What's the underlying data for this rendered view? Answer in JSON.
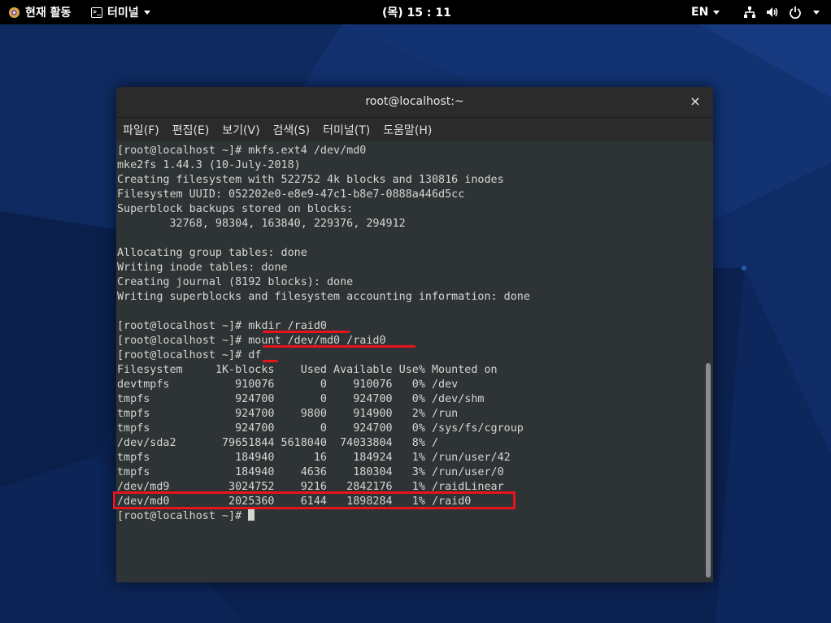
{
  "topbar": {
    "activities_label": "현재 활동",
    "app_menu_label": "터미널",
    "clock": "(목) 15 : 11",
    "language": "EN",
    "icons": [
      "network-icon",
      "volume-icon",
      "power-icon"
    ]
  },
  "window": {
    "title": "root@localhost:~",
    "close_glyph": "×",
    "menu": [
      "파일(F)",
      "편집(E)",
      "보기(V)",
      "검색(S)",
      "터미널(T)",
      "도움말(H)"
    ]
  },
  "terminal": {
    "lines": [
      "[root@localhost ~]# mkfs.ext4 /dev/md0",
      "mke2fs 1.44.3 (10-July-2018)",
      "Creating filesystem with 522752 4k blocks and 130816 inodes",
      "Filesystem UUID: 052202e0-e8e9-47c1-b8e7-0888a446d5cc",
      "Superblock backups stored on blocks:",
      "        32768, 98304, 163840, 229376, 294912",
      "",
      "Allocating group tables: done",
      "Writing inode tables: done",
      "Creating journal (8192 blocks): done",
      "Writing superblocks and filesystem accounting information: done",
      "",
      "[root@localhost ~]# mkdir /raid0",
      "[root@localhost ~]# mount /dev/md0 /raid0",
      "[root@localhost ~]# df",
      "Filesystem     1K-blocks    Used Available Use% Mounted on",
      "devtmpfs          910076       0    910076   0% /dev",
      "tmpfs             924700       0    924700   0% /dev/shm",
      "tmpfs             924700    9800    914900   2% /run",
      "tmpfs             924700       0    924700   0% /sys/fs/cgroup",
      "/dev/sda2       79651844 5618040  74033804   8% /",
      "tmpfs             184940      16    184924   1% /run/user/42",
      "tmpfs             184940    4636    180304   3% /run/user/0",
      "/dev/md9         3024752    9216   2842176   1% /raidLinear",
      "/dev/md0         2025360    6144   1898284   1% /raid0",
      "[root@localhost ~]# "
    ]
  },
  "colors": {
    "annotation": "#e8141c",
    "terminal_bg": "#2e3436",
    "terminal_fg": "#d3d7cf"
  }
}
